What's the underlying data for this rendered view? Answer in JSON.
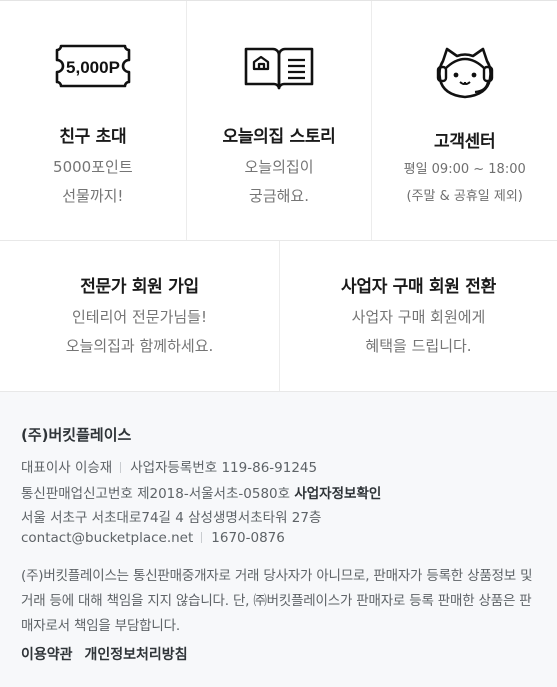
{
  "services": [
    {
      "title": "친구 초대",
      "desc": [
        "5000포인트",
        "선물까지!"
      ],
      "icon": "ticket-5000p-icon",
      "ticket_label": "5,000P"
    },
    {
      "title": "오늘의집 스토리",
      "desc": [
        "오늘의집이",
        "궁금해요."
      ],
      "icon": "open-book-icon"
    },
    {
      "title": "고객센터",
      "desc": [
        "평일 09:00 ~ 18:00",
        "(주말 & 공휴일 제외)"
      ],
      "icon": "cat-headset-icon"
    },
    {
      "title": "전문가 회원 가입",
      "desc": [
        "인테리어 전문가님들!",
        "오늘의집과 함께하세요."
      ]
    },
    {
      "title": "사업자 구매 회원 전환",
      "desc": [
        "사업자 구매 회원에게",
        "혜택을 드립니다."
      ]
    }
  ],
  "footer": {
    "company": "(주)버킷플레이스",
    "ceo": "대표이사 이승재",
    "biz_reg": "사업자등록번호 119-86-91245",
    "ecommerce_reg": "통신판매업신고번호 제2018-서울서초-0580호",
    "biz_info_link": "사업자정보확인",
    "address": "서울 서초구 서초대로74길 4 삼성생명서초타워 27층",
    "email": "contact@bucketplace.net",
    "phone": "1670-0876",
    "notice": "(주)버킷플레이스는 통신판매중개자로 거래 당사자가 아니므로, 판매자가 등록한 상품정보 및 거래 등에 대해 책임을 지지 않습니다. 단, ㈜버킷플레이스가 판매자로 등록 판매한 상품은 판매자로서 책임을 부담합니다.",
    "terms": "이용약관",
    "privacy": "개인정보처리방침"
  },
  "colors": {
    "title": "#1a1a1a",
    "desc": "#757575",
    "footer_bg": "#f7f8fa",
    "footer_text": "#5e6367"
  }
}
